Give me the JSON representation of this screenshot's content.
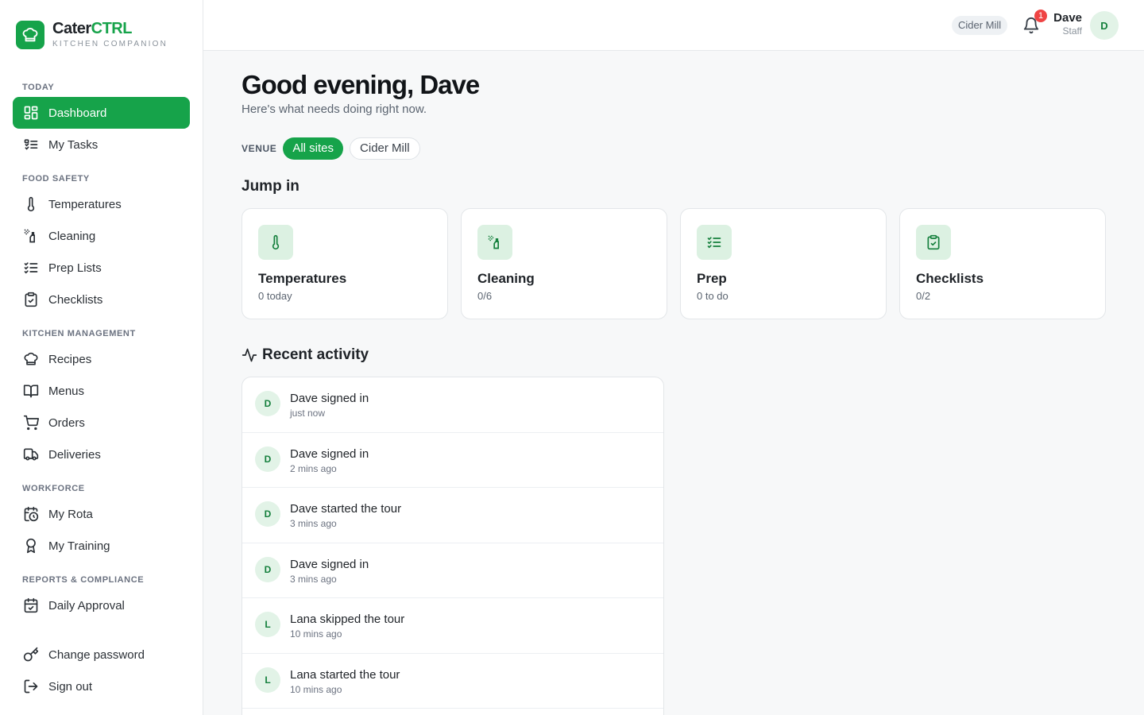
{
  "brand": {
    "name_main": "Cater",
    "name_accent": "CTRL",
    "tagline": "KITCHEN COMPANION",
    "accent_color": "#16a34a"
  },
  "sidebar": {
    "sections": [
      {
        "title": "TODAY",
        "items": [
          {
            "label": "Dashboard",
            "icon": "dashboard-icon",
            "active": true
          },
          {
            "label": "My Tasks",
            "icon": "task-list-icon"
          }
        ]
      },
      {
        "title": "FOOD SAFETY",
        "items": [
          {
            "label": "Temperatures",
            "icon": "thermometer-icon"
          },
          {
            "label": "Cleaning",
            "icon": "spray-bottle-icon"
          },
          {
            "label": "Prep Lists",
            "icon": "checklist-icon"
          },
          {
            "label": "Checklists",
            "icon": "clipboard-check-icon"
          }
        ]
      },
      {
        "title": "KITCHEN MANAGEMENT",
        "items": [
          {
            "label": "Recipes",
            "icon": "chef-hat-icon"
          },
          {
            "label": "Menus",
            "icon": "book-icon"
          },
          {
            "label": "Orders",
            "icon": "cart-icon"
          },
          {
            "label": "Deliveries",
            "icon": "truck-icon"
          }
        ]
      },
      {
        "title": "WORKFORCE",
        "items": [
          {
            "label": "My Rota",
            "icon": "calendar-clock-icon"
          },
          {
            "label": "My Training",
            "icon": "award-icon"
          }
        ]
      },
      {
        "title": "REPORTS & COMPLIANCE",
        "items": [
          {
            "label": "Daily Approval",
            "icon": "calendar-check-icon"
          }
        ]
      }
    ],
    "footer": [
      {
        "label": "Change password",
        "icon": "key-icon"
      },
      {
        "label": "Sign out",
        "icon": "sign-out-icon"
      }
    ]
  },
  "topbar": {
    "venue": "Cider Mill",
    "notification_count": "1",
    "user_name": "Dave",
    "user_role": "Staff",
    "avatar_initial": "D"
  },
  "main": {
    "greeting": "Good evening, Dave",
    "subtitle": "Here's what needs doing right now.",
    "venue_label": "VENUE",
    "venue_options": [
      "All sites",
      "Cider Mill"
    ],
    "venue_selected": "All sites",
    "jump_in_title": "Jump in",
    "cards": [
      {
        "title": "Temperatures",
        "sub": "0 today",
        "icon": "thermometer-icon"
      },
      {
        "title": "Cleaning",
        "sub": "0/6",
        "icon": "spray-bottle-icon"
      },
      {
        "title": "Prep",
        "sub": "0 to do",
        "icon": "checklist-icon"
      },
      {
        "title": "Checklists",
        "sub": "0/2",
        "icon": "clipboard-check-icon"
      }
    ],
    "activity_title": "Recent activity",
    "activity": [
      {
        "initial": "D",
        "text": "Dave signed in",
        "time": "just now"
      },
      {
        "initial": "D",
        "text": "Dave signed in",
        "time": "2 mins ago"
      },
      {
        "initial": "D",
        "text": "Dave started the tour",
        "time": "3 mins ago"
      },
      {
        "initial": "D",
        "text": "Dave signed in",
        "time": "3 mins ago"
      },
      {
        "initial": "L",
        "text": "Lana skipped the tour",
        "time": "10 mins ago"
      },
      {
        "initial": "L",
        "text": "Lana started the tour",
        "time": "10 mins ago"
      }
    ]
  }
}
